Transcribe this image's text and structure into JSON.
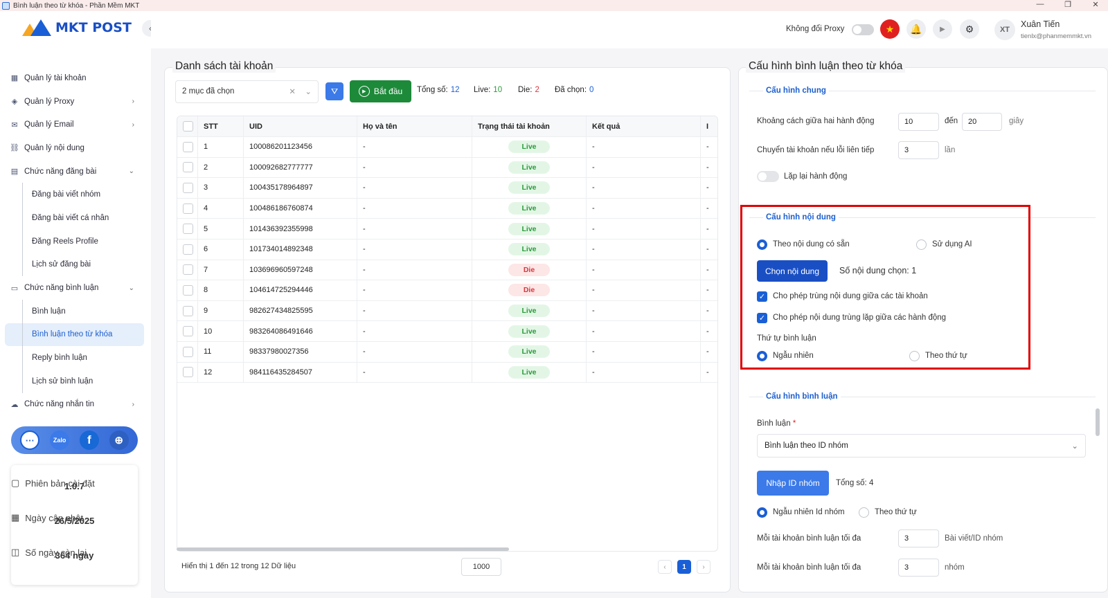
{
  "window": {
    "title": "Bình luận theo từ khóa - Phần Mềm MKT",
    "min": "—",
    "max": "❐",
    "close": "✕"
  },
  "logo": {
    "text": "MKT POST"
  },
  "sidebar": {
    "collapse": "‹",
    "items": [
      {
        "label": "Quản lý tài khoản",
        "icon": "grid-icon",
        "glyph": "▦"
      },
      {
        "label": "Quản lý Proxy",
        "icon": "layers-icon",
        "glyph": "◈",
        "arrow": "›"
      },
      {
        "label": "Quản lý Email",
        "icon": "mail-icon",
        "glyph": "✉",
        "arrow": "›"
      },
      {
        "label": "Quản lý nội dung",
        "icon": "link-icon",
        "glyph": "⛓"
      },
      {
        "label": "Chức năng đăng bài",
        "icon": "post-icon",
        "glyph": "▤",
        "arrow": "⌄"
      },
      {
        "label": "Đăng bài viết nhóm",
        "sub": true
      },
      {
        "label": "Đăng bài viết cá nhân",
        "sub": true
      },
      {
        "label": "Đăng Reels Profile",
        "sub": true
      },
      {
        "label": "Lịch sử đăng bài",
        "sub": true
      },
      {
        "label": "Chức năng bình luận",
        "icon": "comment-icon",
        "glyph": "▭",
        "arrow": "⌄"
      },
      {
        "label": "Bình luận",
        "sub": true
      },
      {
        "label": "Bình luận theo từ khóa",
        "sub": true,
        "active": true
      },
      {
        "label": "Reply bình luận",
        "sub": true
      },
      {
        "label": "Lịch sử bình luận",
        "sub": true
      },
      {
        "label": "Chức năng nhắn tin",
        "icon": "chat-icon",
        "glyph": "☁",
        "arrow": "›"
      }
    ],
    "social": {
      "support": "···",
      "zalo": "Zalo",
      "facebook": "f",
      "web": "⊕"
    },
    "info": {
      "version_label": "Phiên bản cài đặt",
      "version": "1.0.7",
      "update_label": "Ngày cập nhật",
      "update": "26/5/2025",
      "days_label": "Số ngày còn lại",
      "days": "364 ngày"
    }
  },
  "header": {
    "proxy_label": "Không đổi Proxy",
    "flag": "★",
    "bell": "🔔",
    "play": "▶",
    "gear": "⚙",
    "avatar": "XT",
    "user_name": "Xuân Tiến",
    "user_email": "tienlx@phanmemmkt.vn"
  },
  "accounts": {
    "title": "Danh sách tài khoản",
    "select_value": "2 mục đã chọn",
    "clear": "✕",
    "dropdown": "⌄",
    "filter": "⛛",
    "start_label": "Bắt đầu",
    "total_label": "Tổng số:",
    "total": "12",
    "live_label": "Live:",
    "live": "10",
    "die_label": "Die:",
    "die": "2",
    "selected_label": "Đã chọn:",
    "selected": "0",
    "columns": [
      "STT",
      "UID",
      "Họ và tên",
      "Trạng thái tài khoản",
      "Kết quả",
      "I"
    ],
    "rows": [
      {
        "stt": "1",
        "uid": "100086201123456",
        "name": "-",
        "status": "Live",
        "result": "-"
      },
      {
        "stt": "2",
        "uid": "100092682777777",
        "name": "-",
        "status": "Live",
        "result": "-"
      },
      {
        "stt": "3",
        "uid": "100435178964897",
        "name": "-",
        "status": "Live",
        "result": "-"
      },
      {
        "stt": "4",
        "uid": "100486186760874",
        "name": "-",
        "status": "Live",
        "result": "-"
      },
      {
        "stt": "5",
        "uid": "101436392355998",
        "name": "-",
        "status": "Live",
        "result": "-"
      },
      {
        "stt": "6",
        "uid": "101734014892348",
        "name": "-",
        "status": "Live",
        "result": "-"
      },
      {
        "stt": "7",
        "uid": "103696960597248",
        "name": "-",
        "status": "Die",
        "result": "-"
      },
      {
        "stt": "8",
        "uid": "104614725294446",
        "name": "-",
        "status": "Die",
        "result": "-"
      },
      {
        "stt": "9",
        "uid": "982627434825595",
        "name": "-",
        "status": "Live",
        "result": "-"
      },
      {
        "stt": "10",
        "uid": "983264086491646",
        "name": "-",
        "status": "Live",
        "result": "-"
      },
      {
        "stt": "11",
        "uid": "98337980027356",
        "name": "-",
        "status": "Live",
        "result": "-"
      },
      {
        "stt": "12",
        "uid": "984116435284507",
        "name": "-",
        "status": "Live",
        "result": "-"
      }
    ],
    "footer": "Hiển thị 1 đến 12 trong 12 Dữ liệu",
    "page_size": "1000",
    "prev": "‹",
    "page": "1",
    "next": "›"
  },
  "config": {
    "title": "Cấu hình bình luận theo từ khóa",
    "general": {
      "title": "Cấu hình chung",
      "interval_label": "Khoảng cách giữa hai hành động",
      "interval_from": "10",
      "to_label": "đến",
      "interval_to": "20",
      "unit_sec": "giây",
      "switch_label": "Chuyển tài khoản nếu lỗi liên tiếp",
      "switch_value": "3",
      "unit_times": "lần",
      "repeat_label": "Lặp lại hành động"
    },
    "content": {
      "title": "Cấu hình nội dung",
      "opt_existing": "Theo nội dung có sẵn",
      "opt_ai": "Sử dụng AI",
      "choose_btn": "Chọn nội dung",
      "count_label": "Số nội dung chọn: 1",
      "allow_dup_accounts": "Cho phép trùng nội dung giữa các tài khoản",
      "allow_dup_actions": "Cho phép nội dung trùng lặp giữa các hành động",
      "check_mark": "✓",
      "order_label": "Thứ tự bình luận",
      "order_random": "Ngẫu nhiên",
      "order_seq": "Theo thứ tự"
    },
    "comment": {
      "title": "Cấu hình bình luận",
      "comment_label": "Bình luận",
      "required": "*",
      "comment_value": "Bình luận theo ID nhóm",
      "dropdown": "⌄",
      "input_btn": "Nhập ID nhóm",
      "total_label": "Tổng số: 4",
      "opt_random_id": "Ngẫu nhiên Id nhóm",
      "opt_seq": "Theo thứ tự",
      "max1_label": "Mỗi tài khoản bình luận tối đa",
      "max1_value": "3",
      "max1_unit": "Bài viết/ID nhóm",
      "max2_label": "Mỗi tài khoản bình luận tối đa",
      "max2_value": "3",
      "max2_unit": "nhóm"
    }
  }
}
